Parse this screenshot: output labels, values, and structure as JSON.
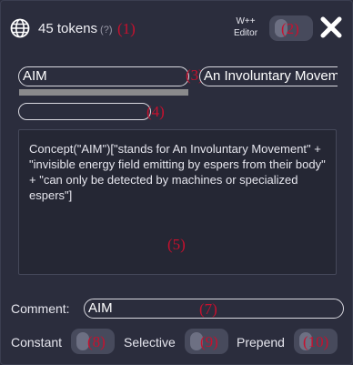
{
  "header": {
    "token_count": "45 tokens",
    "help": "(?)",
    "editor_label_line1": "W++",
    "editor_label_line2": "Editor",
    "globe_icon": "globe-icon",
    "close_icon": "close-icon"
  },
  "entry": {
    "primary_key": "AIM",
    "secondary_key": "An Involuntary Movem",
    "tertiary_key": "",
    "content": "Concept(\"AIM\")[\"stands for An Involuntary Movement\" + \"invisible energy field emitting by espers from their body\" + \"can only be detected by machines or specialized espers\"]",
    "comment_label": "Comment:",
    "comment_value": "AIM",
    "constant_label": "Constant",
    "selective_label": "Selective",
    "prepend_label": "Prepend"
  },
  "annotations": {
    "a1": "(1)",
    "a2": "(2)",
    "a3": "(3)",
    "a4": "(4)",
    "a5": "(5)",
    "a7": "(7)",
    "a8": "(8)",
    "a9": "(9)",
    "a10": "(10)"
  },
  "colors": {
    "background": "#2b2d3d",
    "annotation": "#c8102e",
    "toggle_track": "#474a5c",
    "toggle_knob": "#6d7083"
  }
}
